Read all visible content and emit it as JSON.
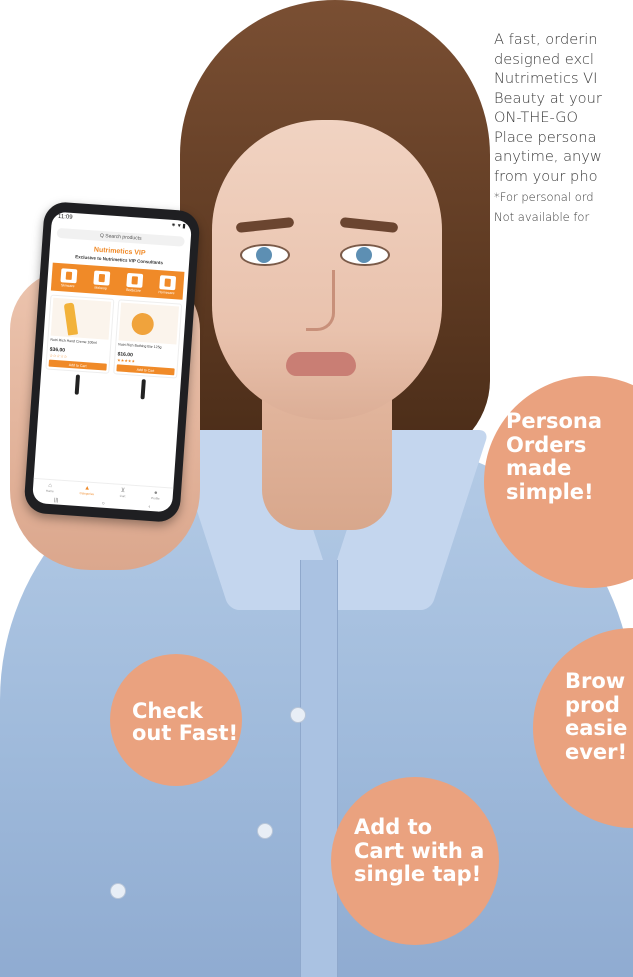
{
  "copy": {
    "lines": [
      "A fast, orderin",
      "designed excl",
      "Nutrimetics VI",
      "Beauty at your",
      "ON-THE-GO",
      "Place persona",
      "anytime, anyw",
      "from your pho"
    ],
    "notes": [
      "*For personal ord",
      "Not available for"
    ]
  },
  "bubbles": {
    "personal": [
      "Persona",
      "Orders",
      "made",
      "simple!"
    ],
    "browse": [
      "Brow",
      "prod",
      "easie",
      "ever!"
    ],
    "checkout": [
      "Check",
      "out Fast!"
    ],
    "add_to_cart": [
      "Add to",
      "Cart with a",
      "single tap!"
    ]
  },
  "phone": {
    "time": "11:09",
    "status_right": "⁕ ▾ ▮",
    "search_placeholder": "Q  Search products",
    "title": "Nutrimetics VIP",
    "subtitle": "Exclusive to Nutrimetics VIP Consultants",
    "categories": [
      "Skincare",
      "Makeup",
      "Bodycare",
      "Homecare"
    ],
    "products": [
      {
        "name": "Nutri Rich Hand Creme 100ml",
        "price": "$36.00",
        "stars": "☆☆☆☆☆",
        "button": "Add to Cart"
      },
      {
        "name": "Nutri Rich Bathing Bar 125g",
        "price": "$16.00",
        "stars": "★★★★★",
        "button": "Add to Cart"
      }
    ],
    "nav": [
      "Home",
      "Categories",
      "Cart",
      "Profile"
    ],
    "homebar": [
      "|||",
      "○",
      "‹"
    ]
  },
  "colors": {
    "accent": "#f08a28",
    "bubble": "#eaa27f",
    "shirt": "#a9c2e2",
    "text": "#3a3a3a"
  }
}
